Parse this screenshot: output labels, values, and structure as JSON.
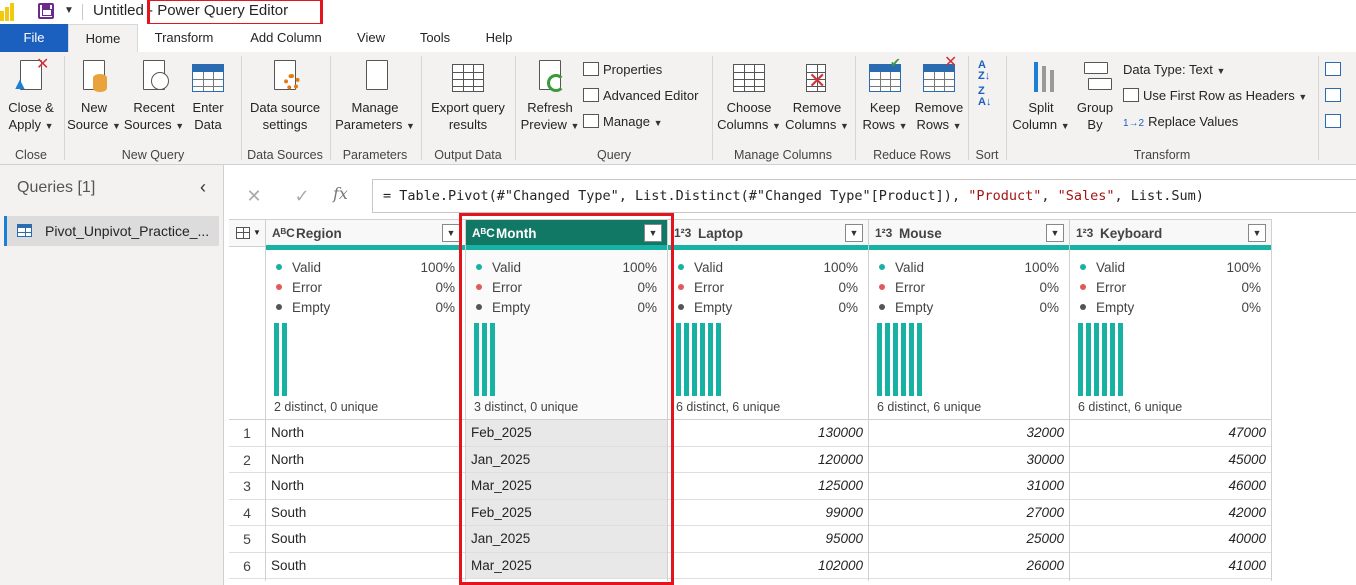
{
  "title": {
    "prefix": "Untitled",
    "suffix": "- Power Query Editor"
  },
  "tabs": [
    "File",
    "Home",
    "Transform",
    "Add Column",
    "View",
    "Tools",
    "Help"
  ],
  "ribbon": {
    "close": {
      "label1": "Close &",
      "label2": "Apply",
      "group": "Close"
    },
    "new_query": {
      "new_source": [
        "New",
        "Source"
      ],
      "recent_sources": [
        "Recent",
        "Sources"
      ],
      "enter_data": [
        "Enter",
        "Data"
      ],
      "group": "New Query"
    },
    "data_sources": {
      "settings": [
        "Data source",
        "settings"
      ],
      "group": "Data Sources"
    },
    "parameters": {
      "manage": [
        "Manage",
        "Parameters"
      ],
      "group": "Parameters"
    },
    "output_data": {
      "export": [
        "Export query",
        "results"
      ],
      "group": "Output Data"
    },
    "query": {
      "refresh": [
        "Refresh",
        "Preview"
      ],
      "properties": "Properties",
      "advanced_editor": "Advanced Editor",
      "manage": "Manage",
      "group": "Query"
    },
    "manage_columns": {
      "choose": [
        "Choose",
        "Columns"
      ],
      "remove": [
        "Remove",
        "Columns"
      ],
      "group": "Manage Columns"
    },
    "reduce_rows": {
      "keep": [
        "Keep",
        "Rows"
      ],
      "remove": [
        "Remove",
        "Rows"
      ],
      "group": "Reduce Rows"
    },
    "sort": {
      "group": "Sort"
    },
    "transform": {
      "split": [
        "Split",
        "Column"
      ],
      "group_by": [
        "Group",
        "By"
      ],
      "data_type": "Data Type: Text",
      "first_row": "Use First Row as Headers",
      "replace": "Replace Values",
      "group": "Transform"
    }
  },
  "queries_pane": {
    "title": "Queries [1]",
    "items": [
      "Pivot_Unpivot_Practice_..."
    ]
  },
  "formula": {
    "prefix": "= Table.Pivot(#\"Changed Type\", List.Distinct(#\"Changed Type\"[Product]), ",
    "str1": "\"Product\"",
    "mid": ", ",
    "str2": "\"Sales\"",
    "suffix": ", List.Sum)"
  },
  "profile_labels": {
    "valid": "Valid",
    "error": "Error",
    "empty": "Empty"
  },
  "colors": {
    "valid": "#17b2a4",
    "error": "#e05a5a",
    "empty": "#555555",
    "selected_header": "#117865",
    "highlight": "#e3141b"
  },
  "columns": [
    {
      "name": "Region",
      "type": "ABC",
      "valid": "100%",
      "error": "0%",
      "empty": "0%",
      "distinct": "2 distinct, 0 unique",
      "bars": 2,
      "values": [
        "North",
        "North",
        "North",
        "South",
        "South",
        "South"
      ]
    },
    {
      "name": "Month",
      "type": "ABC",
      "valid": "100%",
      "error": "0%",
      "empty": "0%",
      "distinct": "3 distinct, 0 unique",
      "bars": 3,
      "values": [
        "Feb_2025",
        "Jan_2025",
        "Mar_2025",
        "Feb_2025",
        "Jan_2025",
        "Mar_2025"
      ]
    },
    {
      "name": "Laptop",
      "type": "123",
      "valid": "100%",
      "error": "0%",
      "empty": "0%",
      "distinct": "6 distinct, 6 unique",
      "bars": 6,
      "values": [
        "130000",
        "120000",
        "125000",
        "99000",
        "95000",
        "102000"
      ]
    },
    {
      "name": "Mouse",
      "type": "123",
      "valid": "100%",
      "error": "0%",
      "empty": "0%",
      "distinct": "6 distinct, 6 unique",
      "bars": 6,
      "values": [
        "32000",
        "30000",
        "31000",
        "27000",
        "25000",
        "26000"
      ]
    },
    {
      "name": "Keyboard",
      "type": "123",
      "valid": "100%",
      "error": "0%",
      "empty": "0%",
      "distinct": "6 distinct, 6 unique",
      "bars": 6,
      "values": [
        "47000",
        "45000",
        "46000",
        "42000",
        "40000",
        "41000"
      ]
    }
  ],
  "row_numbers": [
    "1",
    "2",
    "3",
    "4",
    "5",
    "6"
  ]
}
